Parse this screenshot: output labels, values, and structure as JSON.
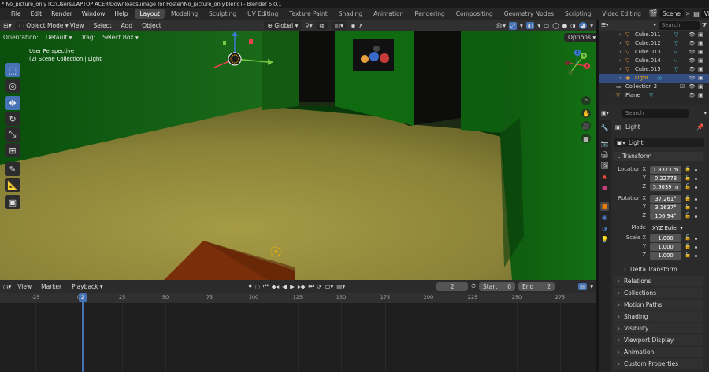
{
  "title_bar": "* No_picture_only [C:\\Users\\LAPTOP ACER\\Downloads\\image for Poster\\No_picture_only.blend] - Blender 5.0.1",
  "menus": [
    "File",
    "Edit",
    "Render",
    "Window",
    "Help"
  ],
  "workspaces": [
    "Layout",
    "Modeling",
    "Sculpting",
    "UV Editing",
    "Texture Paint",
    "Shading",
    "Animation",
    "Rendering",
    "Compositing",
    "Geometry Nodes",
    "Scripting",
    "Video Editing"
  ],
  "active_workspace": "Layout",
  "scene": {
    "label": "Scene",
    "view_layer": "ViewLayer"
  },
  "viewport": {
    "mode": "Object Mode",
    "menus": [
      "View",
      "Select",
      "Add",
      "Object"
    ],
    "transform_orientation": "Global",
    "orientation_label": "Orientation:",
    "orientation_value": "Default",
    "drag_label": "Drag:",
    "drag_value": "Select Box",
    "options": "Options",
    "info_line1": "User Perspective",
    "info_line2": "(2) Scene Collection | Light",
    "gizmo_x": "X",
    "gizmo_y": "Y",
    "gizmo_z": "Z"
  },
  "timeline": {
    "menus": [
      "View",
      "Marker",
      "Playback"
    ],
    "current_frame": "2",
    "start_label": "Start",
    "start": "0",
    "end_label": "End",
    "end": "2",
    "ruler": [
      "-25",
      "0",
      "25",
      "50",
      "75",
      "100",
      "125",
      "150",
      "175",
      "200",
      "225",
      "250",
      "275"
    ],
    "playhead_label": "2"
  },
  "outliner": {
    "search_placeholder": "Search",
    "rows": [
      {
        "name": "Cube.011",
        "type": "mesh",
        "selected": false
      },
      {
        "name": "Cube.012",
        "type": "mesh",
        "selected": false
      },
      {
        "name": "Cube.013",
        "type": "mesh",
        "selected": false
      },
      {
        "name": "Cube.014",
        "type": "mesh",
        "selected": false
      },
      {
        "name": "Cube.015",
        "type": "mesh",
        "selected": false
      },
      {
        "name": "Light",
        "type": "light",
        "selected": true
      },
      {
        "name": "Collection 2",
        "type": "collection",
        "selected": false
      },
      {
        "name": "Plane",
        "type": "mesh",
        "selected": false
      }
    ]
  },
  "properties": {
    "search_placeholder": "Search",
    "object_name": "Light",
    "datablock": "Light",
    "transform_header": "Transform",
    "location_label": "Location X",
    "location": [
      "1.8373 m",
      "0.22778",
      "5.9039 m"
    ],
    "rotation_label": "Rotation X",
    "rotation": [
      "37.261°",
      "3.1637°",
      "106.94°"
    ],
    "mode_label": "Mode",
    "mode_value": "XYZ Euler",
    "scale_label": "Scale X",
    "scale": [
      "1.000",
      "1.000",
      "1.000"
    ],
    "axis_y": "Y",
    "axis_z": "Z",
    "delta_transform": "Delta Transform",
    "panels": [
      "Relations",
      "Collections",
      "Motion Paths",
      "Shading",
      "Visibility",
      "Viewport Display",
      "Animation",
      "Custom Properties"
    ]
  },
  "colors": {
    "accent": "#4772b3",
    "orange": "#e87d0d",
    "mesh": "#e6a23c",
    "light": "#4fc2cf"
  }
}
